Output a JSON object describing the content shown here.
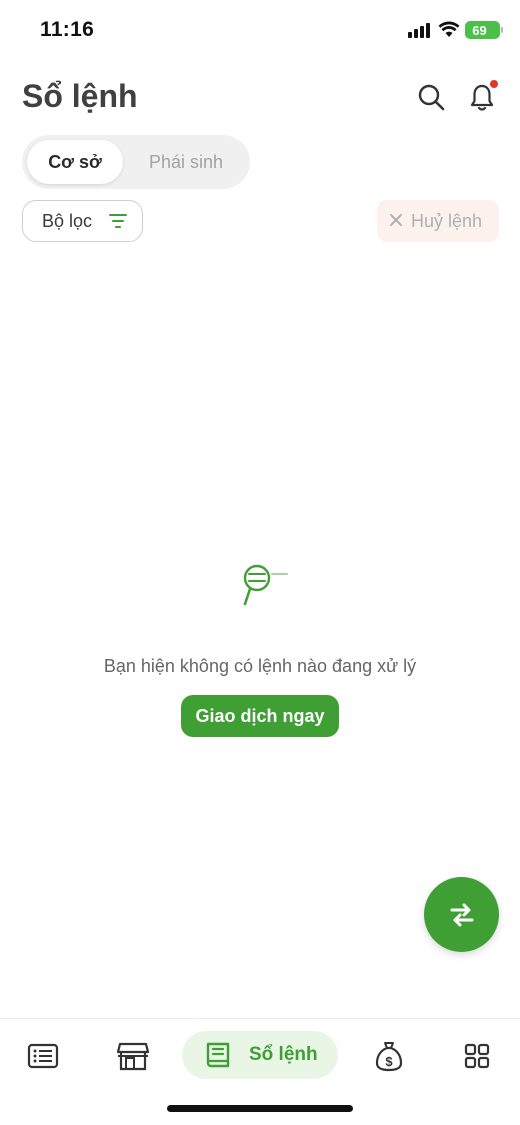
{
  "status_bar": {
    "time": "11:16",
    "battery": "69"
  },
  "header": {
    "title": "Sổ lệnh",
    "icons": [
      "search-icon",
      "bell-icon"
    ]
  },
  "segment": {
    "tabs": [
      {
        "label": "Cơ sở",
        "active": true
      },
      {
        "label": "Phái sinh",
        "active": false
      }
    ]
  },
  "toolbar": {
    "filter_label": "Bộ lọc",
    "cancel_label": "Huỷ lệnh"
  },
  "empty_state": {
    "message": "Bạn hiện không có lệnh nào đang xử lý",
    "action_label": "Giao dịch ngay"
  },
  "bottom_nav": {
    "items": [
      {
        "icon": "list-icon",
        "label": "",
        "active": false
      },
      {
        "icon": "store-icon",
        "label": "",
        "active": false
      },
      {
        "icon": "book-icon",
        "label": "Sổ lệnh",
        "active": true
      },
      {
        "icon": "money-bag-icon",
        "label": "",
        "active": false
      },
      {
        "icon": "grid-icon",
        "label": "",
        "active": false
      }
    ]
  },
  "colors": {
    "accent": "#3f9f35",
    "accent_light": "#e9f6e6",
    "notification": "#e0352b",
    "cancel_bg": "#fdf1ee"
  }
}
